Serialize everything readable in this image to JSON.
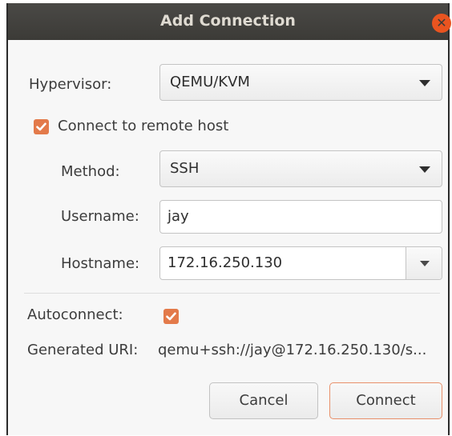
{
  "dialog": {
    "title": "Add Connection",
    "close_icon": "close-icon",
    "accent_color": "#e95420"
  },
  "hypervisor": {
    "label": "Hypervisor:",
    "value": "QEMU/KVM"
  },
  "remote": {
    "checkbox_label": "Connect to remote host",
    "checked": true,
    "method_label": "Method:",
    "method_value": "SSH",
    "username_label": "Username:",
    "username_value": "jay",
    "hostname_label": "Hostname:",
    "hostname_value": "172.16.250.130"
  },
  "autoconnect": {
    "label": "Autoconnect:",
    "checked": true
  },
  "uri": {
    "label": "Generated URI:",
    "value": "qemu+ssh://jay@172.16.250.130/s..."
  },
  "buttons": {
    "cancel": "Cancel",
    "connect": "Connect"
  }
}
